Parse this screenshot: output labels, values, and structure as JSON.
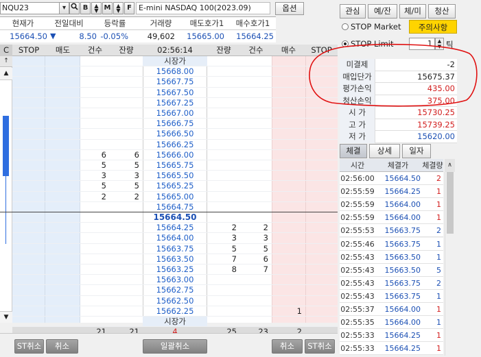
{
  "toolbar": {
    "symbol": "NQU23",
    "name": "E-mini NASDAQ 100(2023.09)",
    "options": "옵션",
    "btn_b": "B",
    "btn_m": "M",
    "btn_f": "F"
  },
  "quote": {
    "headers": [
      "현재가",
      "전일대비",
      "등락률",
      "거래량",
      "매도호가1",
      "매수호가1"
    ],
    "values": [
      "15664.50",
      "8.50",
      "-0.05%",
      "49,602",
      "15665.00",
      "15664.25"
    ],
    "arrow": "▼"
  },
  "book_header": {
    "c": "C",
    "stop_l": "STOP",
    "ask": "매도",
    "cnt_l": "건수",
    "rem_l": "잔량",
    "time": "02:56:14",
    "rem_r": "잔량",
    "cnt_r": "건수",
    "bid": "매수",
    "stop_r": "STOP"
  },
  "book": [
    {
      "p": "시장가",
      "ar": "",
      "ac": "",
      "br": "",
      "bc": "",
      "b": ""
    },
    {
      "p": "15668.00",
      "ar": "",
      "ac": "",
      "br": "",
      "bc": "",
      "b": ""
    },
    {
      "p": "15667.75",
      "ar": "",
      "ac": "",
      "br": "",
      "bc": "",
      "b": ""
    },
    {
      "p": "15667.50",
      "ar": "",
      "ac": "",
      "br": "",
      "bc": "",
      "b": ""
    },
    {
      "p": "15667.25",
      "ar": "",
      "ac": "",
      "br": "",
      "bc": "",
      "b": ""
    },
    {
      "p": "15667.00",
      "ar": "",
      "ac": "",
      "br": "",
      "bc": "",
      "b": ""
    },
    {
      "p": "15666.75",
      "ar": "",
      "ac": "",
      "br": "",
      "bc": "",
      "b": ""
    },
    {
      "p": "15666.50",
      "ar": "",
      "ac": "",
      "br": "",
      "bc": "",
      "b": ""
    },
    {
      "p": "15666.25",
      "ar": "",
      "ac": "",
      "br": "",
      "bc": "",
      "b": ""
    },
    {
      "p": "15666.00",
      "ar": "6",
      "ac": "6",
      "br": "",
      "bc": "",
      "b": ""
    },
    {
      "p": "15665.75",
      "ar": "5",
      "ac": "5",
      "br": "",
      "bc": "",
      "b": ""
    },
    {
      "p": "15665.50",
      "ar": "3",
      "ac": "3",
      "br": "",
      "bc": "",
      "b": ""
    },
    {
      "p": "15665.25",
      "ar": "5",
      "ac": "5",
      "br": "",
      "bc": "",
      "b": ""
    },
    {
      "p": "15665.00",
      "ar": "2",
      "ac": "2",
      "br": "",
      "bc": "",
      "b": ""
    },
    {
      "p": "15664.75",
      "ar": "",
      "ac": "",
      "br": "",
      "bc": "",
      "b": ""
    },
    {
      "p": "15664.50",
      "ar": "",
      "ac": "",
      "br": "",
      "bc": "",
      "b": ""
    },
    {
      "p": "15664.25",
      "ar": "",
      "ac": "",
      "br": "2",
      "bc": "2",
      "b": ""
    },
    {
      "p": "15664.00",
      "ar": "",
      "ac": "",
      "br": "3",
      "bc": "3",
      "b": ""
    },
    {
      "p": "15663.75",
      "ar": "",
      "ac": "",
      "br": "5",
      "bc": "5",
      "b": ""
    },
    {
      "p": "15663.50",
      "ar": "",
      "ac": "",
      "br": "7",
      "bc": "6",
      "b": ""
    },
    {
      "p": "15663.25",
      "ar": "",
      "ac": "",
      "br": "8",
      "bc": "7",
      "b": ""
    },
    {
      "p": "15663.00",
      "ar": "",
      "ac": "",
      "br": "",
      "bc": "",
      "b": ""
    },
    {
      "p": "15662.75",
      "ar": "",
      "ac": "",
      "br": "",
      "bc": "",
      "b": ""
    },
    {
      "p": "15662.50",
      "ar": "",
      "ac": "",
      "br": "",
      "bc": "",
      "b": ""
    },
    {
      "p": "15662.25",
      "ar": "",
      "ac": "",
      "br": "",
      "bc": "",
      "b": "1"
    },
    {
      "p": "시장가",
      "ar": "",
      "ac": "",
      "br": "",
      "bc": "",
      "b": ""
    }
  ],
  "book_totals": {
    "ask_rem": "21",
    "ask_cnt": "21",
    "diff": "4",
    "bid_rem": "25",
    "bid_cnt": "23",
    "bid": "2"
  },
  "bottom": {
    "st_cancel_l": "ST취소",
    "cancel_l": "취소",
    "bulk_cancel": "일괄취소",
    "cancel_r": "취소",
    "st_cancel_r": "ST취소"
  },
  "side_tabs": [
    "관심",
    "예/잔",
    "체/미",
    "청산"
  ],
  "order": {
    "stop_market": "STOP Market",
    "caution": "주의사항",
    "stop_limit": "STOP Limit",
    "ticks": "1",
    "tick_unit": "틱"
  },
  "position": [
    {
      "label": "미결제",
      "value": "-2",
      "color": "#222222"
    },
    {
      "label": "매입단가",
      "value": "15675.37",
      "color": "#222222"
    },
    {
      "label": "평가손익",
      "value": "435.00",
      "color": "#d21e1e"
    },
    {
      "label": "청산손익",
      "value": "375.00",
      "color": "#d21e1e"
    },
    {
      "label": "시 가",
      "value": "15730.25",
      "color": "#d21e1e"
    },
    {
      "label": "고 가",
      "value": "15739.25",
      "color": "#d21e1e"
    },
    {
      "label": "저 가",
      "value": "15620.00",
      "color": "#1c50b4"
    }
  ],
  "trade_tabs": [
    "체결",
    "상세",
    "일자"
  ],
  "trades_header": {
    "time": "시간",
    "price": "체결가",
    "qty": "체결량"
  },
  "trades": [
    {
      "t": "02:56:00",
      "p": "15664.50",
      "q": "2",
      "qc": "#d21e1e"
    },
    {
      "t": "02:55:59",
      "p": "15664.25",
      "q": "1",
      "qc": "#d21e1e"
    },
    {
      "t": "02:55:59",
      "p": "15664.00",
      "q": "1",
      "qc": "#d21e1e"
    },
    {
      "t": "02:55:59",
      "p": "15664.00",
      "q": "1",
      "qc": "#d21e1e"
    },
    {
      "t": "02:55:53",
      "p": "15663.75",
      "q": "2",
      "qc": "#1c50b4"
    },
    {
      "t": "02:55:46",
      "p": "15663.75",
      "q": "1",
      "qc": "#1c50b4"
    },
    {
      "t": "02:55:43",
      "p": "15663.50",
      "q": "1",
      "qc": "#1c50b4"
    },
    {
      "t": "02:55:43",
      "p": "15663.50",
      "q": "5",
      "qc": "#1c50b4"
    },
    {
      "t": "02:55:43",
      "p": "15663.75",
      "q": "2",
      "qc": "#1c50b4"
    },
    {
      "t": "02:55:43",
      "p": "15663.75",
      "q": "1",
      "qc": "#1c50b4"
    },
    {
      "t": "02:55:37",
      "p": "15664.00",
      "q": "1",
      "qc": "#d21e1e"
    },
    {
      "t": "02:55:35",
      "p": "15664.00",
      "q": "1",
      "qc": "#1c50b4"
    },
    {
      "t": "02:55:33",
      "p": "15664.25",
      "q": "1",
      "qc": "#d21e1e"
    },
    {
      "t": "02:55:33",
      "p": "15664.25",
      "q": "1",
      "qc": "#d21e1e"
    }
  ],
  "colors": {
    "ask_bg": "#e4eefa",
    "bid_bg": "#fbe5e5",
    "price_color": "#1f5fc8",
    "down_color": "#1c50b4",
    "up_color": "#d21e1e",
    "annotation": "#e01010"
  }
}
